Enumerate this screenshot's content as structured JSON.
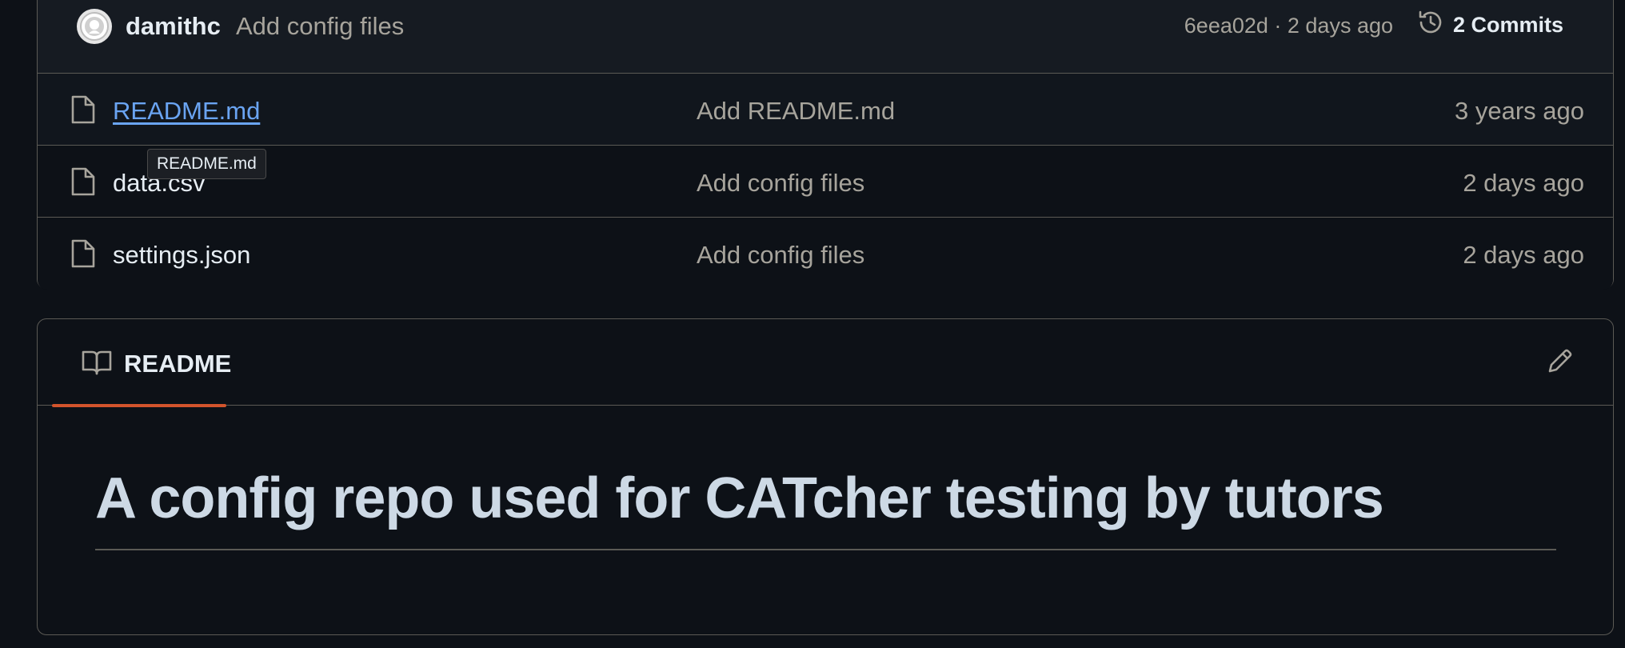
{
  "latest_commit": {
    "author": "damithc",
    "message": "Add config files",
    "meta": "6eea02d · 2 days ago",
    "commits_label": "2 Commits"
  },
  "files": [
    {
      "name": "README.md",
      "commit": "Add README.md",
      "time": "3 years ago",
      "icon": "file-icon"
    },
    {
      "name": "data.csv",
      "commit": "Add config files",
      "time": "2 days ago",
      "icon": "file-icon"
    },
    {
      "name": "settings.json",
      "commit": "Add config files",
      "time": "2 days ago",
      "icon": "file-icon"
    }
  ],
  "tooltip": "README.md",
  "readme": {
    "tab_label": "README",
    "heading": "A config repo used for CATcher testing by tutors"
  },
  "colors": {
    "background": "#0d1117",
    "link": "#6aa4f2",
    "tab_accent": "#d2542c",
    "muted_text": "#a7a49c"
  }
}
